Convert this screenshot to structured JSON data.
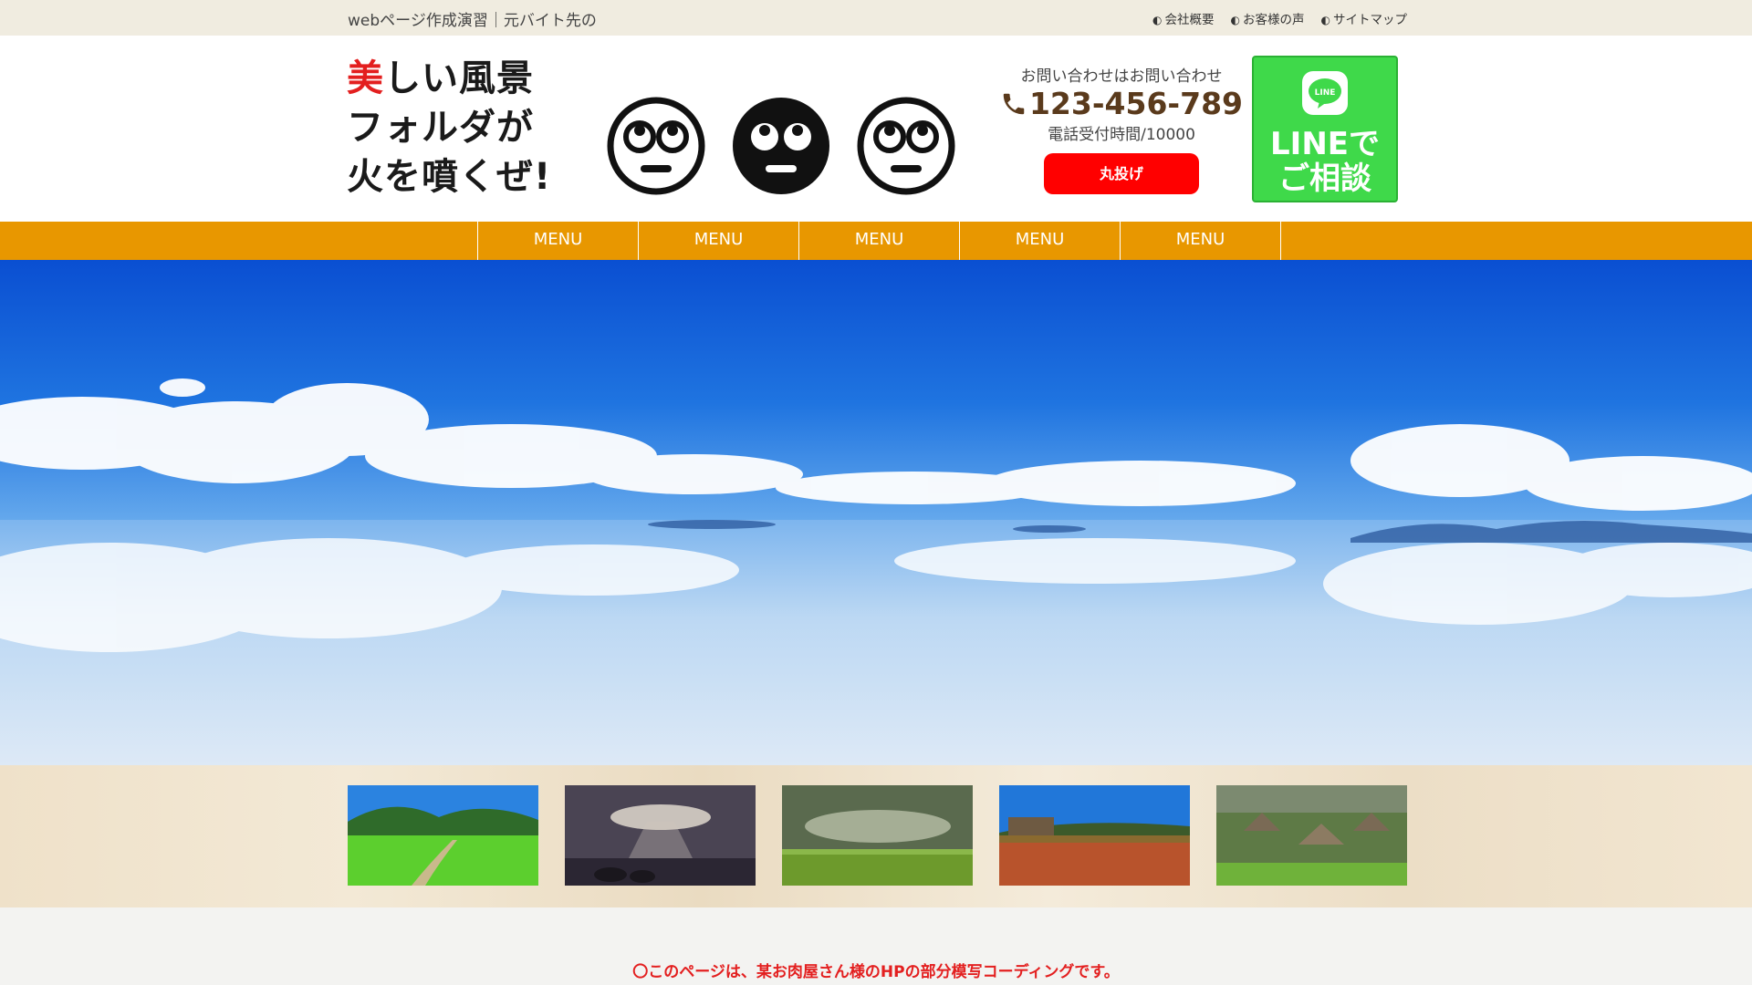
{
  "topbar": {
    "tagline": "webページ作成演習｜元バイト先の",
    "links": [
      "会社概要",
      "お客様の声",
      "サイトマップ"
    ]
  },
  "header": {
    "logo_accent": "美",
    "logo_line1_rest": "しい風景",
    "logo_line2": "フォルダが",
    "logo_line3": "火を噴くぜ!",
    "faces": [
      "rolling-eyes-face-outline-icon",
      "rolling-eyes-face-filled-icon",
      "rolling-eyes-face-outline-icon"
    ]
  },
  "contact": {
    "label": "お問い合わせはお問い合わせ",
    "phone": "123-456-789",
    "hours": "電話受付時間/10000",
    "cta_label": "丸投げ"
  },
  "line_button": {
    "icon_text": "LINE",
    "label": "LINEで\nご相談"
  },
  "nav": {
    "items": [
      "MENU",
      "MENU",
      "MENU",
      "MENU",
      "MENU"
    ]
  },
  "hero": {
    "image": "salt-flat-sky-reflection-photo"
  },
  "thumbnails": [
    "green-hills-path-photo",
    "sunbeam-sea-photo",
    "cloudy-meadow-photo",
    "flower-field-tank-photo",
    "village-aerial-photo"
  ],
  "notice": {
    "text": "〇このページは、某お肉屋さん様のHPの部分模写コーディングです。"
  },
  "colors": {
    "accent_red": "#e31f1f",
    "nav_orange": "#e89700",
    "line_green": "#3fd94a",
    "phone_brown": "#5a3a1c",
    "cta_red": "#ff0000"
  }
}
